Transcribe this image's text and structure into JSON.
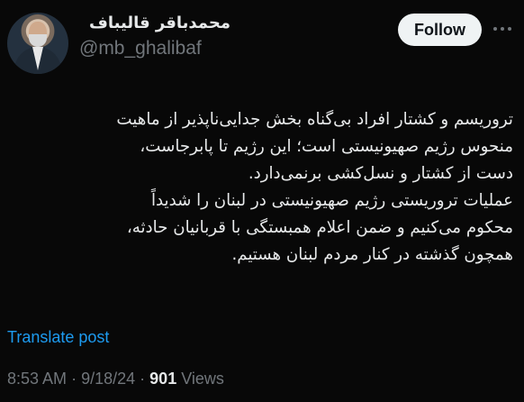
{
  "author": {
    "display_name": "محمدباقر قالیباف",
    "handle": "@mb_ghalibaf"
  },
  "follow_button_label": "Follow",
  "tweet": {
    "lines": [
      "تروریسم و کشتار افراد بی‌گناه بخش جدایی‌ناپذیر از ماهیت",
      "منحوس رژیم صهیونیستی است؛ این رژیم تا پابرجاست،",
      "دست از کشتار و نسل‌کشی برنمی‌دارد.",
      "عملیات تروریستی رژیم صهیونیستی در لبنان را شدیداً",
      "محکوم می‌کنیم و ضمن اعلام همبستگی با قربانیان حادثه،",
      "همچون گذشته در کنار مردم لبنان هستیم."
    ]
  },
  "translate_label": "Translate post",
  "meta": {
    "time": "8:53 AM",
    "date": "9/18/24",
    "separator": "·",
    "views_count": "901",
    "views_label": "Views"
  },
  "icons": {
    "more": "more-horizontal-icon",
    "avatar": "profile-photo"
  },
  "colors": {
    "background": "#080808",
    "text": "#e7e9ea",
    "secondary_text": "#71767b",
    "link": "#1d9bf0",
    "follow_bg": "#eff3f4"
  }
}
